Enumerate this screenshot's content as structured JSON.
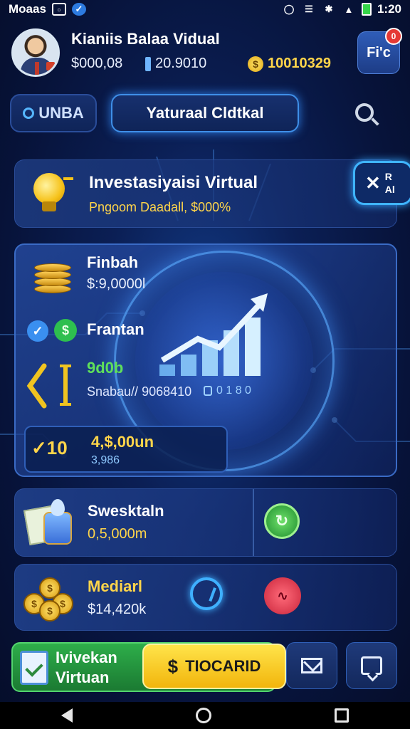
{
  "status_bar": {
    "app_name": "Moaas",
    "time": "1:20",
    "icons": [
      "image-icon",
      "check-circle-icon",
      "alarm-icon",
      "wifi-icon",
      "bluetooth-icon",
      "signal-icon",
      "battery-icon"
    ]
  },
  "header": {
    "user_name": "Kianiis Balaa Vidual",
    "stat_cash": "$000,08",
    "stat_points": "20.9010",
    "stat_coins": "10010329",
    "menu_label": "Fi'c",
    "notification_count": "0"
  },
  "tabs": {
    "tab1_label": "UNBA",
    "tab2_label": "Yaturaal Cldtkal"
  },
  "investment_card": {
    "title": "Investasiyaisi Virtual",
    "subtitle": "Pngoom Daadall, $000%",
    "side_tab": {
      "line1": "R",
      "line2": "Al"
    }
  },
  "main_panel": {
    "item1_label": "Finbah",
    "item1_value": "$:9,0000l",
    "item2_label": "Frantan",
    "item3_value_green": "9d0b",
    "item3_detail": "Snabau// 9068410",
    "item3_code": "0 1 8 0",
    "sub_card": {
      "left_value": "10",
      "main_value": "4,$,00un",
      "sub_value": "3,986"
    }
  },
  "card_sweskt": {
    "title": "Swesktaln",
    "value": "0,5,000m"
  },
  "card_mediarl": {
    "title": "Mediarl",
    "value": "$14,420k"
  },
  "bottom_bar": {
    "virt_label": "Ivivekan Virtuan",
    "trade_label": "TIOCARID",
    "trade_symbol": "$"
  },
  "colors": {
    "accent_blue": "#3fb4ff",
    "gold": "#ffd54a",
    "green": "#2eae4a",
    "background": "#07133a"
  }
}
